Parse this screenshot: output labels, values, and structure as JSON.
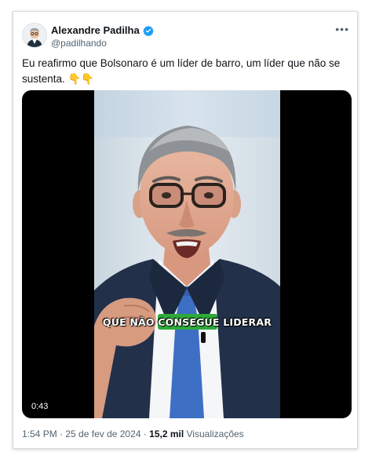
{
  "author": {
    "name": "Alexandre Padilha",
    "handle": "@padilhando",
    "verified_color": "#1d9bf0"
  },
  "more_icon": "more-horizontal-icon",
  "tweet": {
    "text": "Eu reafirmo que Bolsonaro é um líder de barro, um líder que não se sustenta. 👇👇"
  },
  "video": {
    "caption_before": "QUE NÃO ",
    "caption_highlight": "CONSEGUE",
    "caption_after": " LIDERAR",
    "highlight_color": "#2eaa3a",
    "duration": "0:43"
  },
  "meta": {
    "time": "1:54 PM",
    "separator": " · ",
    "date": "25 de fev de 2024",
    "views_count": "15,2 mil",
    "views_label": "Visualizações"
  }
}
